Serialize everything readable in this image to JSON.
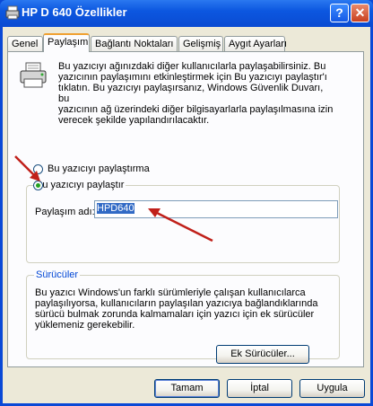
{
  "window": {
    "title": "HP D 640 Özellikler",
    "help_glyph": "?",
    "close_glyph": "✕"
  },
  "tabs": [
    {
      "label": "Genel",
      "active": false
    },
    {
      "label": "Paylaşım",
      "active": true
    },
    {
      "label": "Bağlantı Noktaları",
      "active": false
    },
    {
      "label": "Gelişmiş",
      "active": false
    },
    {
      "label": "Aygıt Ayarları",
      "active": false
    }
  ],
  "sharing": {
    "intro_lines": [
      "Bu yazıcıyı ağınızdaki diğer kullanıcılarla paylaşabilirsiniz.  Bu",
      "yazıcının paylaşımını etkinleştirmek için Bu yazıcıyı paylaştır'ı",
      "tıklatın.  Bu yazıcıyı paylaşırsanız, Windows Güvenlik Duvarı, bu",
      "yazıcının ağ üzerindeki diğer bilgisayarlarla paylaşılmasına izin",
      "verecek şekilde yapılandırılacaktır."
    ],
    "radio_no_share": "Bu yazıcıyı paylaştırma",
    "radio_share": "Bu yazıcıyı paylaştır",
    "selected": "share",
    "share_name_label": "Paylaşım adı:",
    "share_name_value": "HPD640"
  },
  "drivers": {
    "legend": "Sürücüler",
    "text_lines": [
      "Bu yazıcı Windows'un farklı sürümleriyle çalışan kullanıcılarca",
      "paylaşılıyorsa, kullanıcıların paylaşılan yazıcıya bağlandıklarında",
      "sürücü bulmak zorunda kalmamaları için yazıcı için ek sürücüler",
      "yüklemeniz gerekebilir."
    ],
    "extra_drivers_button": "Ek Sürücüler..."
  },
  "buttons": {
    "ok": "Tamam",
    "cancel": "İptal",
    "apply": "Uygula"
  },
  "colors": {
    "arrow": "#c0201a",
    "title_bar": "#0a4bd2",
    "selected_text_bg": "#316ac5"
  }
}
